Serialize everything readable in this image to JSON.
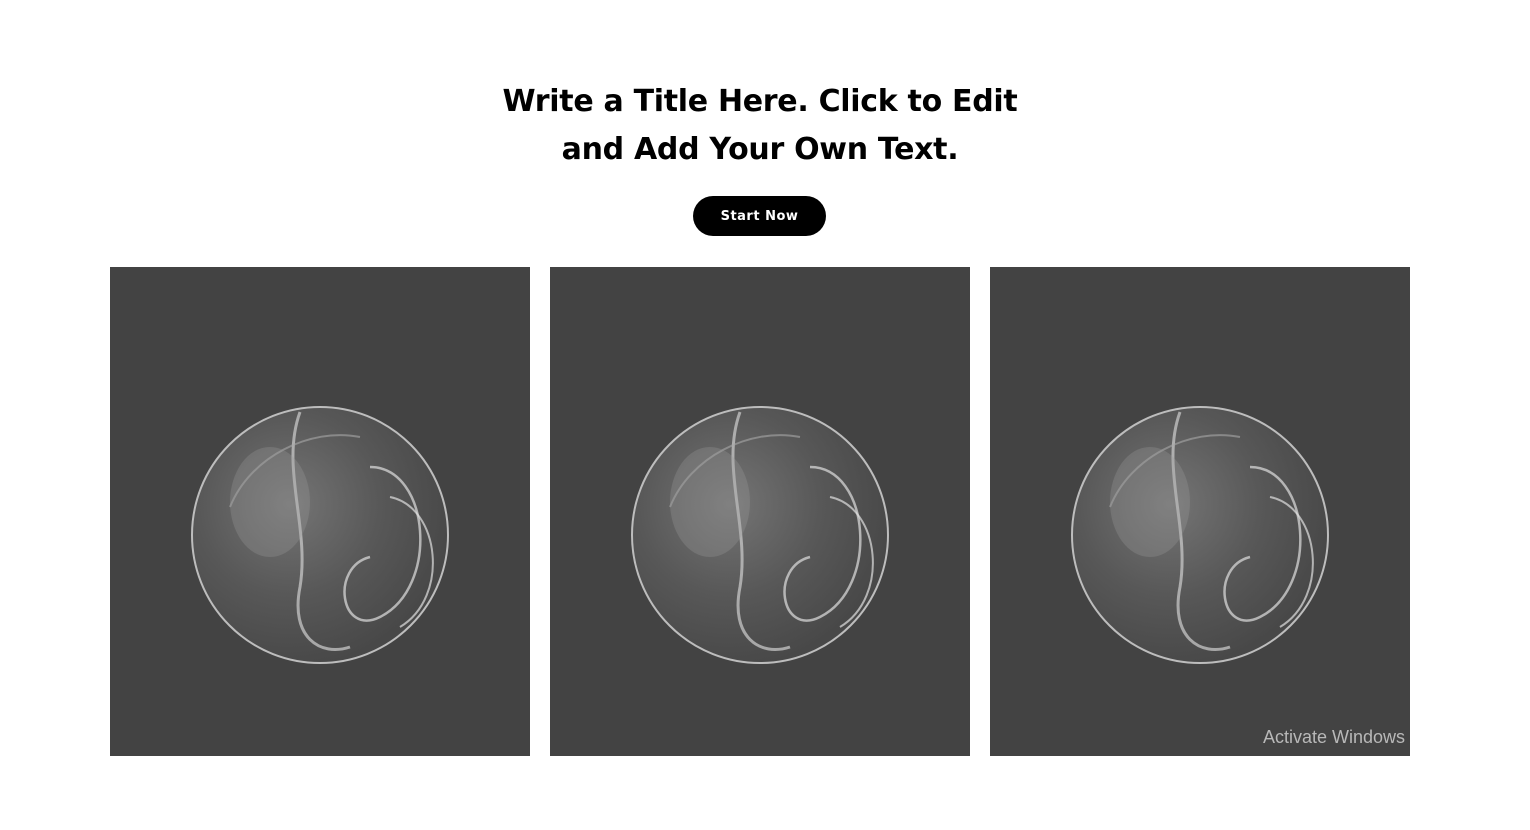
{
  "hero": {
    "title_line1": "Write a Title Here. Click to Edit",
    "title_line2": "and Add Your Own Text.",
    "cta_label": "Start Now"
  },
  "gallery": {
    "tiles": [
      {
        "image": "glass-sphere-image"
      },
      {
        "image": "glass-sphere-image"
      },
      {
        "image": "glass-sphere-image"
      }
    ],
    "tile_background": "#434343"
  },
  "watermark": {
    "text": "Activate Windows"
  },
  "colors": {
    "background": "#ffffff",
    "text": "#000000",
    "button_bg": "#000000",
    "button_text": "#ffffff"
  }
}
